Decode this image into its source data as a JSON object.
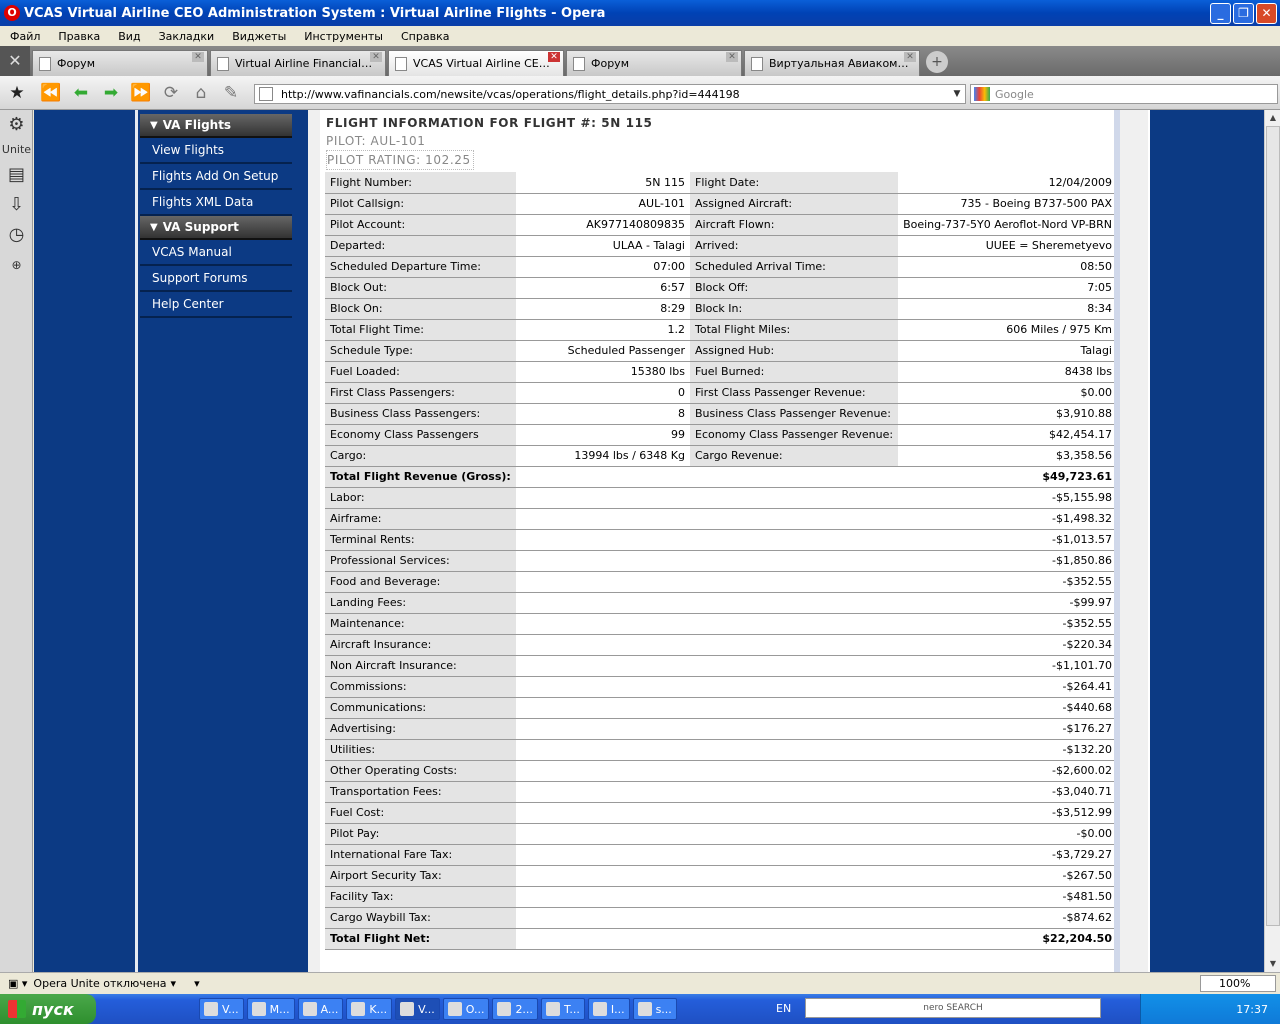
{
  "window": {
    "title": "VCAS Virtual Airline CEO Administration System : Virtual Airline Flights - Opera",
    "opera_icon": "O"
  },
  "menu": [
    "Файл",
    "Правка",
    "Вид",
    "Закладки",
    "Виджеты",
    "Инструменты",
    "Справка"
  ],
  "tabs": [
    {
      "label": "Форум",
      "active": false
    },
    {
      "label": "Virtual Airline Financial S...",
      "active": false
    },
    {
      "label": "VCAS Virtual Airline CEO ...",
      "active": true
    },
    {
      "label": "Форум",
      "active": false
    },
    {
      "label": "Виртуальная Авиакомп...",
      "active": false
    }
  ],
  "address": {
    "url": "http://www.vafinancials.com/newsite/vcas/operations/flight_details.php?id=444198",
    "search_placeholder": "Google"
  },
  "panel": {
    "unite_label": "Unite"
  },
  "sidebar": {
    "sections": [
      {
        "title": "VA Flights",
        "items": [
          "View Flights",
          "Flights Add On Setup",
          "Flights XML Data"
        ]
      },
      {
        "title": "VA Support",
        "items": [
          "VCAS Manual",
          "Support Forums",
          "Help Center"
        ]
      }
    ]
  },
  "flight": {
    "header": "FLIGHT INFORMATION FOR FLIGHT #: 5N 115",
    "pilot": "PILOT: AUL-101",
    "rating": "PILOT RATING: 102.25",
    "details": [
      [
        "Flight Number:",
        "5N 115",
        "Flight Date:",
        "12/04/2009"
      ],
      [
        "Pilot Callsign:",
        "AUL-101",
        "Assigned Aircraft:",
        "735 - Boeing B737-500 PAX"
      ],
      [
        "Pilot Account:",
        "AK977140809835",
        "Aircraft Flown:",
        "Boeing-737-5Y0 Aeroflot-Nord VP-BRN"
      ],
      [
        "Departed:",
        "ULAA - Talagi",
        "Arrived:",
        "UUEE = Sheremetyevo"
      ],
      [
        "Scheduled Departure Time:",
        "07:00",
        "Scheduled Arrival Time:",
        "08:50"
      ],
      [
        "Block Out:",
        "6:57",
        "Block Off:",
        "7:05"
      ],
      [
        "Block On:",
        "8:29",
        "Block In:",
        "8:34"
      ],
      [
        "Total Flight Time:",
        "1.2",
        "Total Flight Miles:",
        "606 Miles / 975 Km"
      ],
      [
        "Schedule Type:",
        "Scheduled Passenger",
        "Assigned Hub:",
        "Talagi"
      ],
      [
        "Fuel Loaded:",
        "15380 lbs",
        "Fuel Burned:",
        "8438 lbs"
      ],
      [
        "First Class Passengers:",
        "0",
        "First Class Passenger Revenue:",
        "$0.00"
      ],
      [
        "Business Class Passengers:",
        "8",
        "Business Class Passenger Revenue:",
        "$3,910.88"
      ],
      [
        "Economy Class Passengers",
        "99",
        "Economy Class Passenger Revenue:",
        "$42,454.17"
      ],
      [
        "Cargo:",
        "13994 lbs / 6348 Kg",
        "Cargo Revenue:",
        "$3,358.56"
      ]
    ],
    "revenue": {
      "label": "Total Flight Revenue (Gross):",
      "value": "$49,723.61"
    },
    "costs": [
      [
        "Labor:",
        "-$5,155.98"
      ],
      [
        "Airframe:",
        "-$1,498.32"
      ],
      [
        "Terminal Rents:",
        "-$1,013.57"
      ],
      [
        "Professional Services:",
        "-$1,850.86"
      ],
      [
        "Food and Beverage:",
        "-$352.55"
      ],
      [
        "Landing Fees:",
        "-$99.97"
      ],
      [
        "Maintenance:",
        "-$352.55"
      ],
      [
        "Aircraft Insurance:",
        "-$220.34"
      ],
      [
        "Non Aircraft Insurance:",
        "-$1,101.70"
      ],
      [
        "Commissions:",
        "-$264.41"
      ],
      [
        "Communications:",
        "-$440.68"
      ],
      [
        "Advertising:",
        "-$176.27"
      ],
      [
        "Utilities:",
        "-$132.20"
      ],
      [
        "Other Operating Costs:",
        "-$2,600.02"
      ],
      [
        "Transportation Fees:",
        "-$3,040.71"
      ],
      [
        "Fuel Cost:",
        "-$3,512.99"
      ],
      [
        "Pilot Pay:",
        "-$0.00"
      ],
      [
        "International Fare Tax:",
        "-$3,729.27"
      ],
      [
        "Airport Security Tax:",
        "-$267.50"
      ],
      [
        "Facility Tax:",
        "-$481.50"
      ],
      [
        "Cargo Waybill Tax:",
        "-$874.62"
      ]
    ],
    "net": {
      "label": "Total Flight Net:",
      "value": "$22,204.50"
    }
  },
  "status": {
    "unite": "Opera Unite отключена",
    "zoom": "100%"
  },
  "taskbar": {
    "start": "пуск",
    "buttons": [
      "V...",
      "M...",
      "A...",
      "K...",
      "V...",
      "O...",
      "2...",
      "T...",
      "I...",
      "s..."
    ],
    "lang": "EN",
    "search": "nero SEARCH",
    "clock": "17:37"
  }
}
